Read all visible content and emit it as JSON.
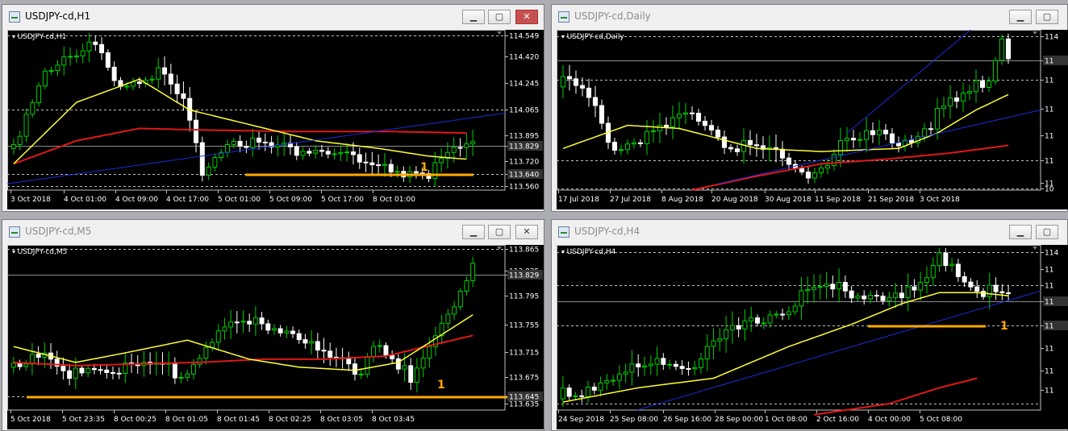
{
  "colors": {
    "background": "#000000",
    "bull": "#00d000",
    "bear": "#ffffff",
    "ma_fast": "#ffff33",
    "ma_slow": "#e01818",
    "trend": "#1c2cd8",
    "support": "#ffaa00",
    "grid": "#c0c0c0",
    "current": "#8c8c8c",
    "label": "#ffffff"
  },
  "buttons": {
    "minimize": "▁",
    "maximize": "▢",
    "close": "✕"
  },
  "windows": [
    {
      "id": "h1",
      "title": "USDJPY-cd,H1",
      "symbol": "USDJPY-cd,H1",
      "active": true,
      "marker": "1",
      "price_labels": [
        "114.549",
        "114.420",
        "114.245",
        "114.065",
        "113.895",
        "113.829",
        "113.720",
        "113.640",
        "113.560"
      ],
      "highlight_prices": [
        "113.829",
        "113.640"
      ],
      "time_labels": [
        "3 Oct 2018",
        "4 Oct 01:00",
        "4 Oct 09:00",
        "4 Oct 17:00",
        "5 Oct 01:00",
        "5 Oct 09:00",
        "5 Oct 17:00",
        "8 Oct 01:00"
      ]
    },
    {
      "id": "daily",
      "title": "USDJPY-cd,Daily",
      "symbol": "USDJPY-cd,Daily",
      "active": false,
      "marker": "",
      "price_labels": [
        "114",
        "11",
        "11",
        "11",
        "11",
        "11",
        "11",
        "10"
      ],
      "highlight_prices": [
        "11"
      ],
      "time_labels": [
        "17 Jul 2018",
        "27 Jul 2018",
        "8 Aug 2018",
        "20 Aug 2018",
        "30 Aug 2018",
        "11 Sep 2018",
        "21 Sep 2018",
        "3 Oct 2018"
      ]
    },
    {
      "id": "m5",
      "title": "USDJPY-cd,M5",
      "symbol": "USDJPY-cd,M5",
      "active": false,
      "marker": "1",
      "price_labels": [
        "113.865",
        "113.835",
        "113.829",
        "113.795",
        "113.755",
        "113.715",
        "113.675",
        "113.645",
        "113.635"
      ],
      "highlight_prices": [
        "113.829",
        "113.645"
      ],
      "time_labels": [
        "5 Oct 2018",
        "5 Oct 23:35",
        "8 Oct 00:25",
        "8 Oct 01:05",
        "8 Oct 01:45",
        "8 Oct 02:25",
        "8 Oct 03:05",
        "8 Oct 03:45"
      ]
    },
    {
      "id": "h4",
      "title": "USDJPY-cd,H4",
      "symbol": "USDJPY-cd,H4",
      "active": false,
      "marker": "1",
      "price_labels": [
        "114",
        "11",
        "11",
        "11",
        "11",
        "11",
        "11",
        "11"
      ],
      "highlight_prices": [
        "11"
      ],
      "time_labels": [
        "24 Sep 2018",
        "25 Sep 08:00",
        "26 Sep 16:00",
        "28 Sep 00:00",
        "1 Oct 08:00",
        "2 Oct 16:00",
        "4 Oct 00:00",
        "5 Oct 08:00"
      ]
    }
  ]
}
